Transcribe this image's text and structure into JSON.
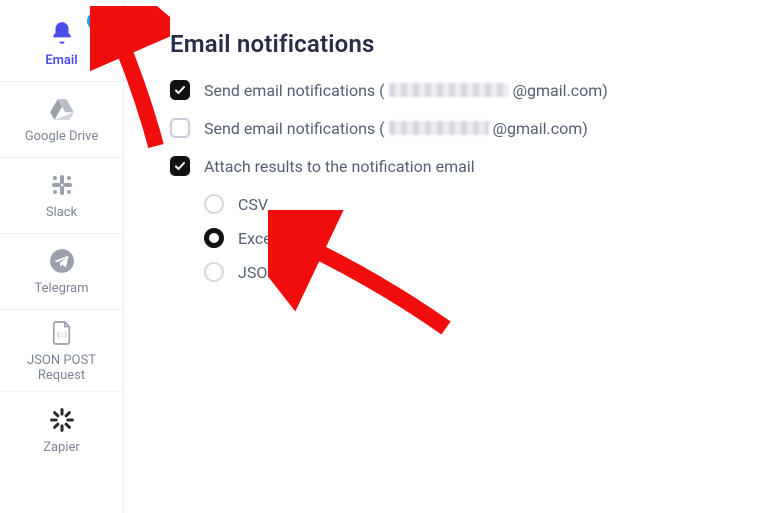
{
  "sidebar": {
    "items": [
      {
        "id": "email",
        "label": "Email",
        "active": true,
        "badge": true
      },
      {
        "id": "google-drive",
        "label": "Google Drive"
      },
      {
        "id": "slack",
        "label": "Slack"
      },
      {
        "id": "telegram",
        "label": "Telegram"
      },
      {
        "id": "json-post",
        "label": "JSON POST\nRequest"
      },
      {
        "id": "zapier",
        "label": "Zapier"
      }
    ]
  },
  "panel": {
    "title": "Email notifications",
    "send1": {
      "checked": true,
      "prefix": "Send email notifications (",
      "suffix": "@gmail.com)"
    },
    "send2": {
      "checked": false,
      "prefix": "Send email notifications (",
      "suffix": "@gmail.com)"
    },
    "attach": {
      "checked": true,
      "label": "Attach results to the notification email"
    },
    "formats": [
      {
        "label": "CSV",
        "selected": false
      },
      {
        "label": "Excel",
        "selected": true
      },
      {
        "label": "JSON",
        "selected": false
      }
    ]
  },
  "colors": {
    "accent": "#4a4de7",
    "badge": "#1e9bf0",
    "text": "#566074",
    "heading": "#2a2d47"
  }
}
